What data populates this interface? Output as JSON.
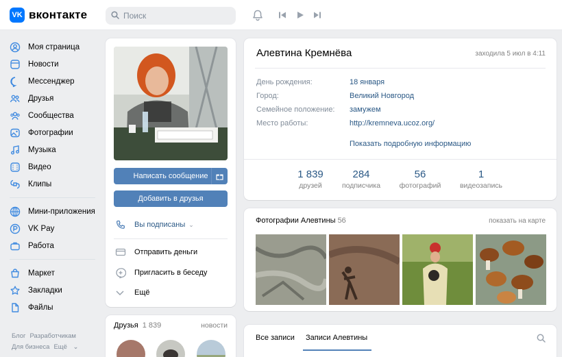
{
  "header": {
    "logo_mark": "VK",
    "logo_text": "вконтакте",
    "search_placeholder": "Поиск",
    "icons": [
      "search-icon",
      "bell-icon",
      "prev-track-icon",
      "play-icon",
      "next-track-icon"
    ]
  },
  "sidebar": {
    "main": [
      {
        "label": "Моя страница",
        "icon": "user-circle-icon"
      },
      {
        "label": "Новости",
        "icon": "news-icon"
      },
      {
        "label": "Мессенджер",
        "icon": "message-icon"
      },
      {
        "label": "Друзья",
        "icon": "friends-icon"
      },
      {
        "label": "Сообщества",
        "icon": "community-icon"
      },
      {
        "label": "Фотографии",
        "icon": "photo-icon"
      },
      {
        "label": "Музыка",
        "icon": "music-icon"
      },
      {
        "label": "Видео",
        "icon": "video-icon"
      },
      {
        "label": "Клипы",
        "icon": "clips-icon"
      }
    ],
    "apps": [
      {
        "label": "Мини-приложения",
        "icon": "apps-icon"
      },
      {
        "label": "VK Pay",
        "icon": "vkpay-icon"
      },
      {
        "label": "Работа",
        "icon": "work-icon"
      }
    ],
    "extra": [
      {
        "label": "Маркет",
        "icon": "market-icon"
      },
      {
        "label": "Закладки",
        "icon": "bookmark-icon"
      },
      {
        "label": "Файлы",
        "icon": "files-icon"
      }
    ],
    "footer": {
      "blog": "Блог",
      "developers": "Разработчикам",
      "business": "Для бизнеса",
      "more": "Ещё"
    }
  },
  "profile_actions": {
    "message_button": "Написать сообщение",
    "add_friend_button": "Добавить в друзья",
    "subscribed": "Вы подписаны",
    "send_money": "Отправить деньги",
    "invite_chat": "Пригласить в беседу",
    "more": "Ещё"
  },
  "friends_block": {
    "title": "Друзья",
    "count": "1 839",
    "news": "новости"
  },
  "profile": {
    "name": "Алевтина Кремнёва",
    "last_seen": "заходила 5 июл в 4:11",
    "fields": [
      {
        "label": "День рождения:",
        "value": "18 января"
      },
      {
        "label": "Город:",
        "value": "Великий Новгород"
      },
      {
        "label": "Семейное положение:",
        "value": "замужем"
      },
      {
        "label": "Место работы:",
        "value": "http://kremneva.ucoz.org/"
      }
    ],
    "show_more": "Показать подробную информацию",
    "counters": [
      {
        "num": "1 839",
        "label": "друзей"
      },
      {
        "num": "284",
        "label": "подписчика"
      },
      {
        "num": "56",
        "label": "фотографий"
      },
      {
        "num": "1",
        "label": "видеозапись"
      }
    ]
  },
  "photos": {
    "title": "Фотографии Алевтины",
    "count": "56",
    "map_link": "показать на карте"
  },
  "wall": {
    "tab_all": "Все записи",
    "tab_own": "Записи Алевтины"
  },
  "colors": {
    "accent": "#5181b8",
    "link": "#2a5885",
    "brand": "#0077ff",
    "muted": "#818c99"
  }
}
